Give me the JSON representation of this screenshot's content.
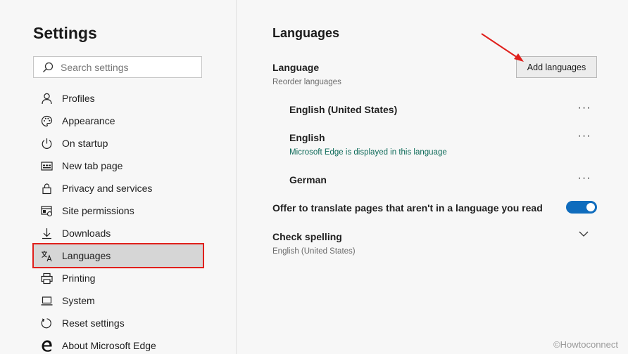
{
  "sidebar": {
    "title": "Settings",
    "search": {
      "placeholder": "Search settings",
      "value": ""
    },
    "items": [
      {
        "label": "Profiles",
        "icon": "person-icon"
      },
      {
        "label": "Appearance",
        "icon": "palette-icon"
      },
      {
        "label": "On startup",
        "icon": "power-icon"
      },
      {
        "label": "New tab page",
        "icon": "new-tab-icon"
      },
      {
        "label": "Privacy and services",
        "icon": "lock-icon"
      },
      {
        "label": "Site permissions",
        "icon": "site-permissions-icon"
      },
      {
        "label": "Downloads",
        "icon": "download-icon"
      },
      {
        "label": "Languages",
        "icon": "language-icon",
        "active": true
      },
      {
        "label": "Printing",
        "icon": "printer-icon"
      },
      {
        "label": "System",
        "icon": "laptop-icon"
      },
      {
        "label": "Reset settings",
        "icon": "reset-icon"
      },
      {
        "label": "About Microsoft Edge",
        "icon": "edge-logo-icon"
      }
    ]
  },
  "main": {
    "title": "Languages",
    "language_section": {
      "label": "Language",
      "sub": "Reorder languages",
      "add_button": "Add languages"
    },
    "languages": [
      {
        "name": "English (United States)",
        "note": ""
      },
      {
        "name": "English",
        "note": "Microsoft Edge is displayed in this language"
      },
      {
        "name": "German",
        "note": ""
      }
    ],
    "more_label": "···",
    "translate": {
      "label": "Offer to translate pages that aren't in a language you read",
      "enabled": true
    },
    "spelling": {
      "label": "Check spelling",
      "sub": "English (United States)"
    }
  },
  "watermark": "©Howtoconnect",
  "colors": {
    "accent": "#0f6cbd",
    "highlight_border": "#e0201c",
    "active_bg": "#d6d6d6",
    "note_text": "#0f6b5a"
  }
}
